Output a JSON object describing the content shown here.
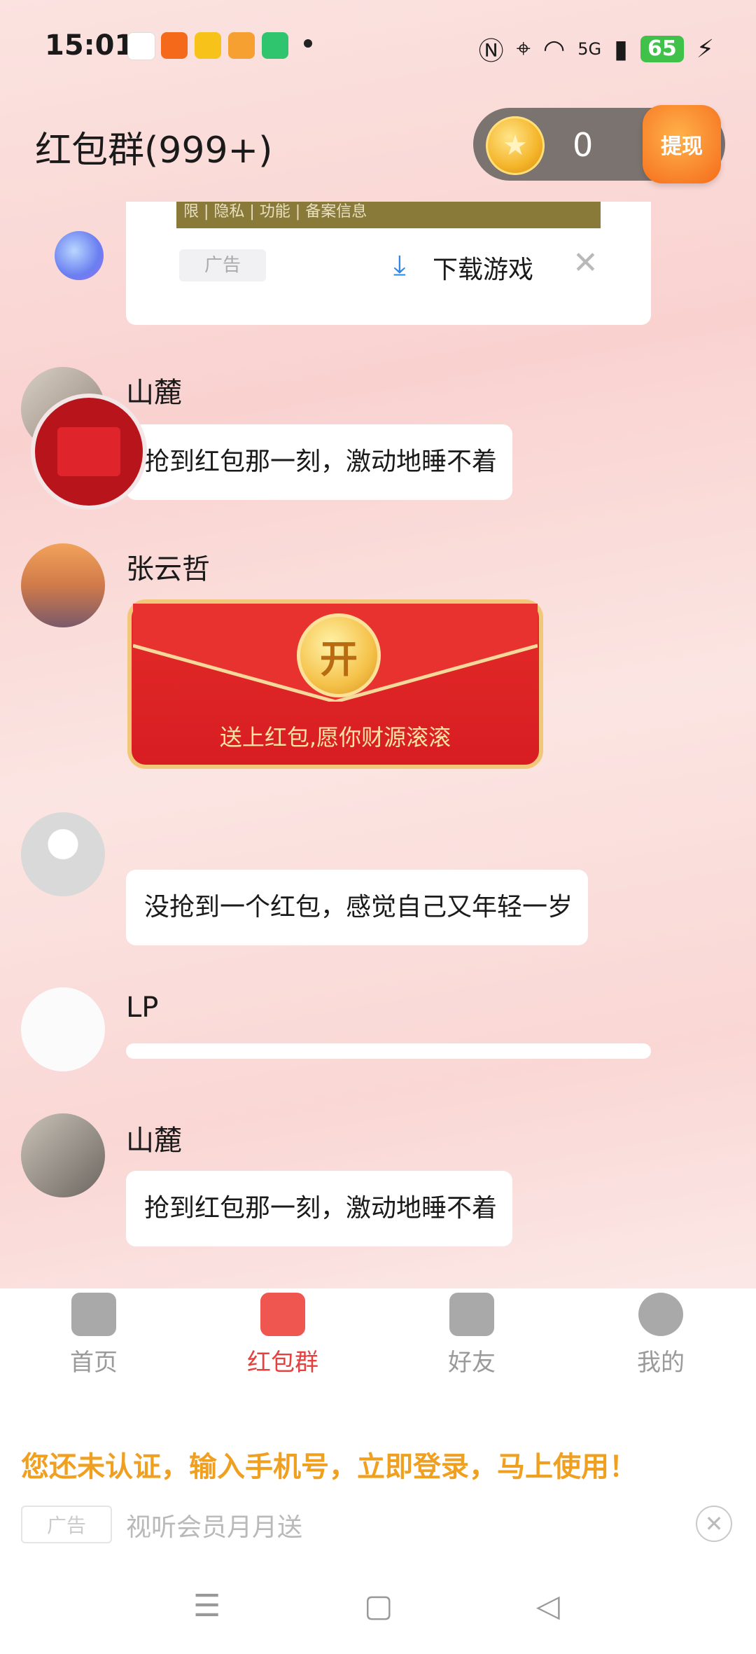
{
  "status": {
    "time": "15:01",
    "network": "5G",
    "battery": "65"
  },
  "header": {
    "title": "红包群(999+)",
    "coins": "0",
    "withdraw_label": "提现"
  },
  "ad_card": {
    "strip_text": "限 | 隐私 | 功能 | 备案信息",
    "tag": "广告",
    "download_label": "下载游戏",
    "close": "✕"
  },
  "messages": [
    {
      "name": "山麓",
      "text": "抢到红包那一刻，激动地睡不着"
    },
    {
      "name": "张云哲",
      "red_packet_label": "开",
      "red_packet_text": "送上红包,愿你财源滚滚"
    },
    {
      "name": "",
      "text": "没抢到一个红包，感觉自己又年轻一岁"
    },
    {
      "name": "LP",
      "text": ""
    },
    {
      "name": "山麓",
      "text": "抢到红包那一刻，激动地睡不着"
    }
  ],
  "tabs": [
    {
      "label": "首页",
      "icon": "home-icon",
      "color": "#9a9a9a"
    },
    {
      "label": "红包群",
      "icon": "red-packet-icon",
      "color": "#e6413e"
    },
    {
      "label": "好友",
      "icon": "friends-icon",
      "color": "#9a9a9a"
    },
    {
      "label": "我的",
      "icon": "profile-icon",
      "color": "#9a9a9a"
    }
  ],
  "bottom_ad": {
    "notice": "您还未认证，输入手机号，立即登录，马上使用！",
    "tag": "广告",
    "text": "视听会员月月送",
    "close": "✕"
  },
  "nav": {
    "menu": "☰",
    "home": "▢",
    "back": "◁"
  }
}
